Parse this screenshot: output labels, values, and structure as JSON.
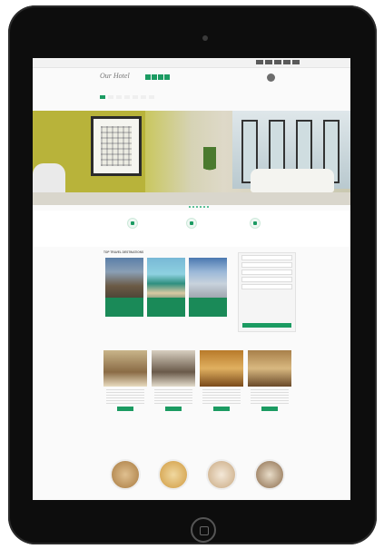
{
  "topbar": {
    "contact_text": "",
    "social_icons": [
      "facebook-icon",
      "twitter-icon",
      "google-plus-icon",
      "rss-icon",
      "youtube-icon"
    ]
  },
  "brand": {
    "logo_text": "Our Hotel",
    "tagline": ""
  },
  "header": {
    "phone_icon": "phone-icon",
    "phone_number": "",
    "language": ""
  },
  "nav": {
    "items": [
      "",
      "",
      "",
      "",
      "",
      "",
      ""
    ]
  },
  "hero": {
    "slides": 6
  },
  "features": [
    {
      "label": "",
      "icon": "wifi-icon"
    },
    {
      "label": "",
      "icon": "parking-icon"
    },
    {
      "label": "",
      "icon": "heart-icon"
    }
  ],
  "destinations": {
    "title": "TOP TRAVEL DESTINATIONS",
    "items": [
      {
        "caption": ""
      },
      {
        "caption": ""
      },
      {
        "caption": ""
      }
    ]
  },
  "booking": {
    "title": "",
    "fields": [
      "",
      "",
      "",
      "",
      ""
    ],
    "submit_label": ""
  },
  "rooms": {
    "title": "",
    "items": [
      {
        "name": "",
        "button": ""
      },
      {
        "name": "",
        "button": ""
      },
      {
        "name": "",
        "button": ""
      },
      {
        "name": "",
        "button": ""
      }
    ]
  },
  "apartments": {
    "title": "",
    "items": [
      {
        "name": ""
      },
      {
        "name": ""
      },
      {
        "name": ""
      },
      {
        "name": ""
      }
    ]
  },
  "colors": {
    "accent": "#1b9b62",
    "tablet_bezel": "#0d0d0d"
  }
}
